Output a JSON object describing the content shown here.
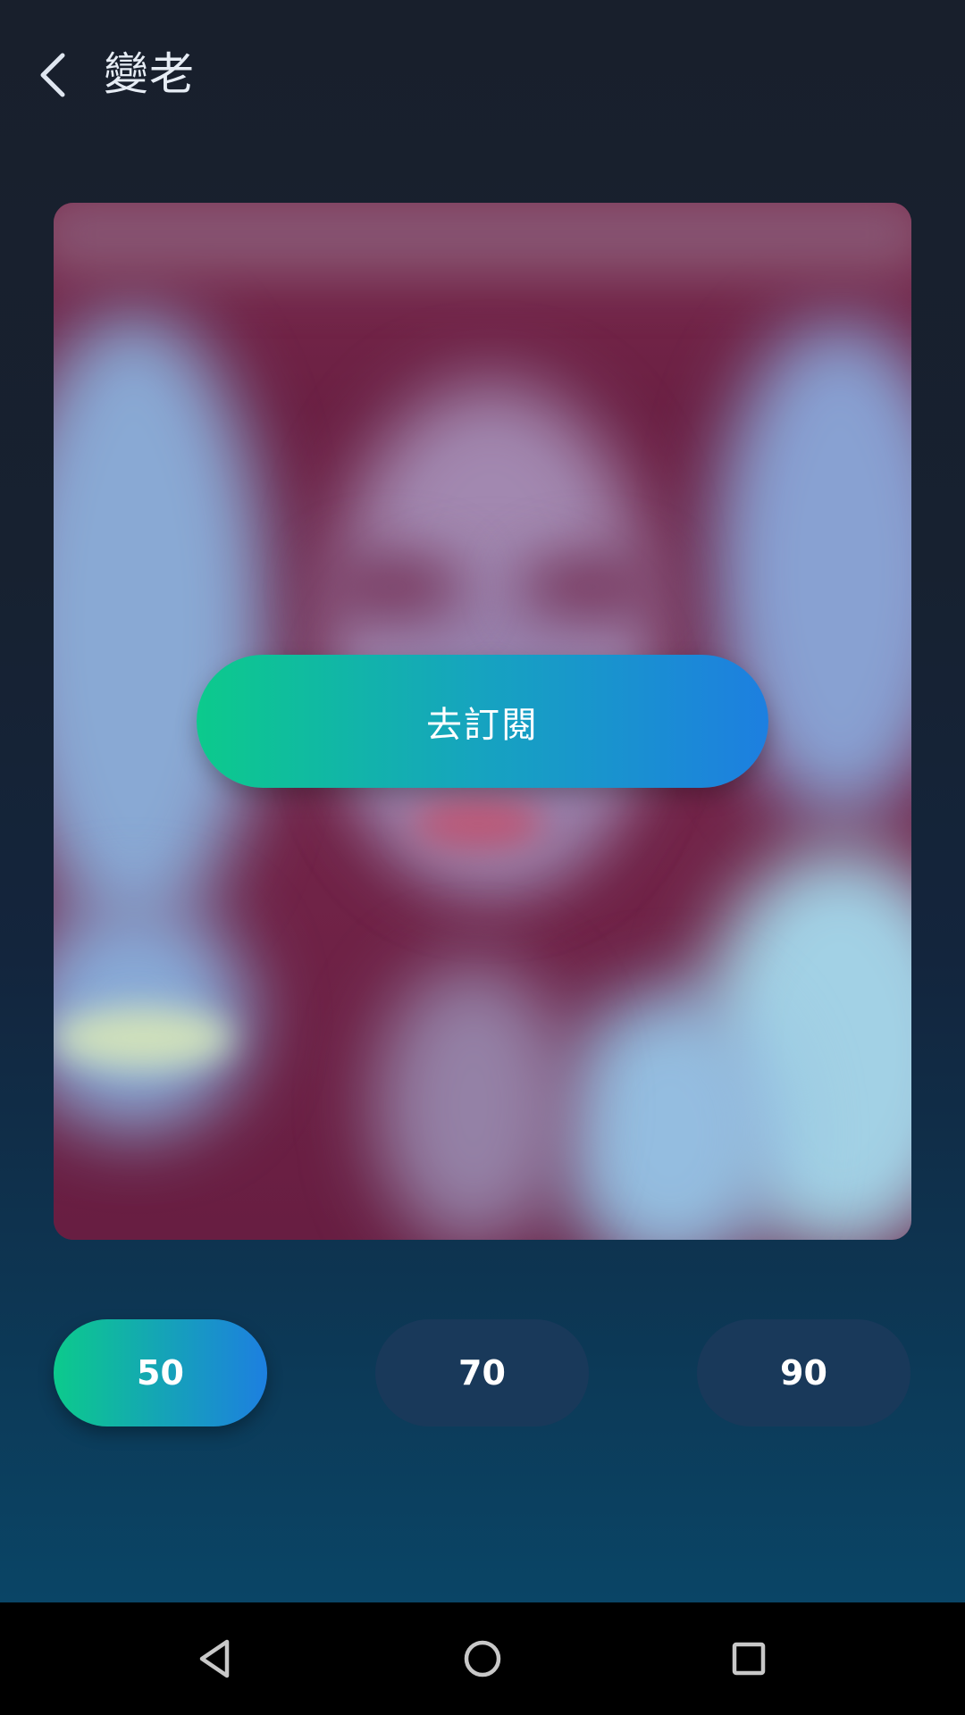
{
  "header": {
    "title": "變老"
  },
  "card": {
    "subscribe_label": "去訂閱"
  },
  "age_options": [
    {
      "label": "50",
      "selected": true
    },
    {
      "label": "70",
      "selected": false
    },
    {
      "label": "90",
      "selected": false
    }
  ],
  "colors": {
    "accent_start": "#0cca8c",
    "accent_end": "#1d7fe0",
    "unselected_pill": "#19395a"
  },
  "navbar": {
    "icons": [
      "back-triangle-icon",
      "home-circle-icon",
      "recents-square-icon"
    ]
  }
}
